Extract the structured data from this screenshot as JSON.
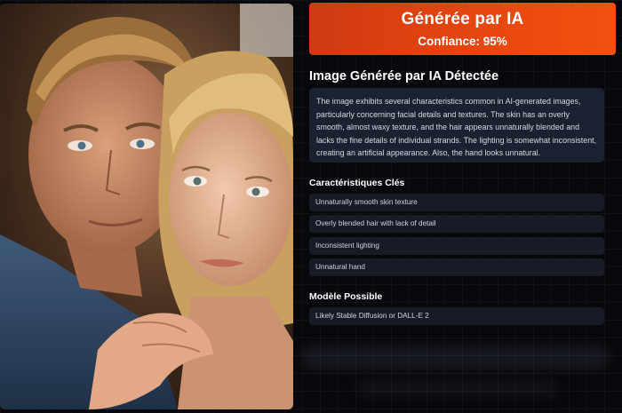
{
  "verdict": {
    "title": "Générée par IA",
    "confidence": "Confiance: 95%",
    "color": "#e8470f"
  },
  "analysis": {
    "heading": "Image Générée par IA Détectée",
    "description": "The image exhibits several characteristics common in AI-generated images, particularly concerning facial details and textures. The skin has an overly smooth, almost waxy texture, and the hair appears unnaturally blended and lacks the fine details of individual strands. The lighting is somewhat inconsistent, creating an artificial appearance. Also, the hand looks unnatural."
  },
  "features": {
    "heading": "Caractéristiques Clés",
    "items": [
      "Unnaturally smooth skin texture",
      "Overly blended hair with lack of detail",
      "Inconsistent lighting",
      "Unnatural hand"
    ]
  },
  "model": {
    "heading": "Modèle Possible",
    "value": "Likely Stable Diffusion or DALL-E 2"
  }
}
